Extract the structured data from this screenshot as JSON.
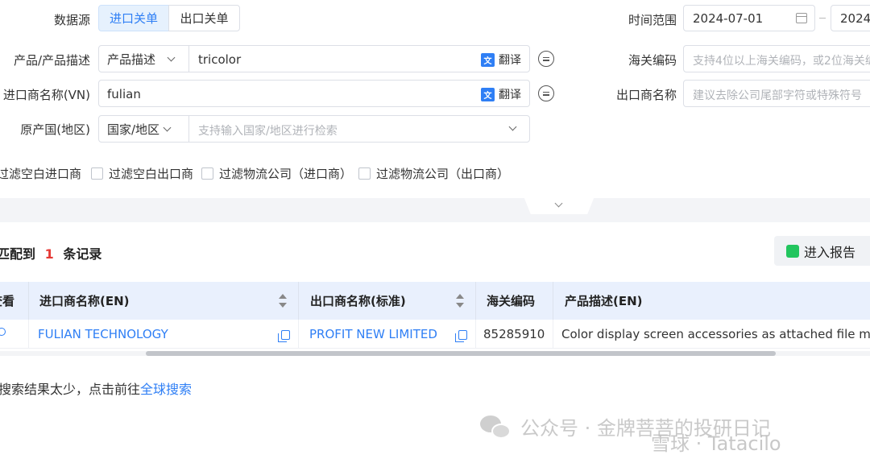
{
  "filters": {
    "datasource_label": "数据源",
    "datasource_tabs": [
      "进口关单",
      "出口关单"
    ],
    "time_range_label": "时间范围",
    "date_start": "2024-07-01",
    "date_end_partial": "2024-",
    "product_label": "产品/产品描述",
    "product_type": "产品描述",
    "product_value": "tricolor",
    "translate_label": "翻译",
    "hs_label": "海关编码",
    "hs_placeholder": "支持4位以上海关编码，或2位海关编码",
    "importer_label": "进口商名称(VN)",
    "importer_value": "fulian",
    "exporter_label": "出口商名称",
    "exporter_placeholder": "建议去除公司尾部字符或特殊符号",
    "origin_label": "原产国(地区)",
    "origin_type": "国家/地区",
    "origin_placeholder": "支持输入国家/地区进行检索",
    "checkboxes": [
      "过滤空白进口商",
      "过滤空白出口商",
      "过滤物流公司（进口商）",
      "过滤物流公司（出口商）"
    ]
  },
  "results": {
    "prefix": "匹配到",
    "count": "1",
    "suffix": "条记录",
    "report_button": "进入报告",
    "columns": [
      "查看",
      "进口商名称(EN)",
      "出口商名称(标准)",
      "海关编码",
      "产品描述(EN)"
    ],
    "rows": [
      {
        "importer": "FULIAN TECHNOLOGY",
        "exporter": "PROFIT NEW LIMITED",
        "hs_code": "85285910",
        "description": "Color display screen accessories as attached file model T"
      }
    ],
    "few_results_text": "搜索结果太少，点击前往",
    "global_search_link": "全球搜索"
  },
  "watermark": {
    "text1": "公众号 · 金牌菩菩的投研日记",
    "text2": "雪球 · Tatacilo"
  },
  "colors": {
    "accent": "#2f7ff5",
    "count_red": "#e53935",
    "header_bg": "#e9f0fd",
    "band_bg": "#f3f4f7"
  }
}
